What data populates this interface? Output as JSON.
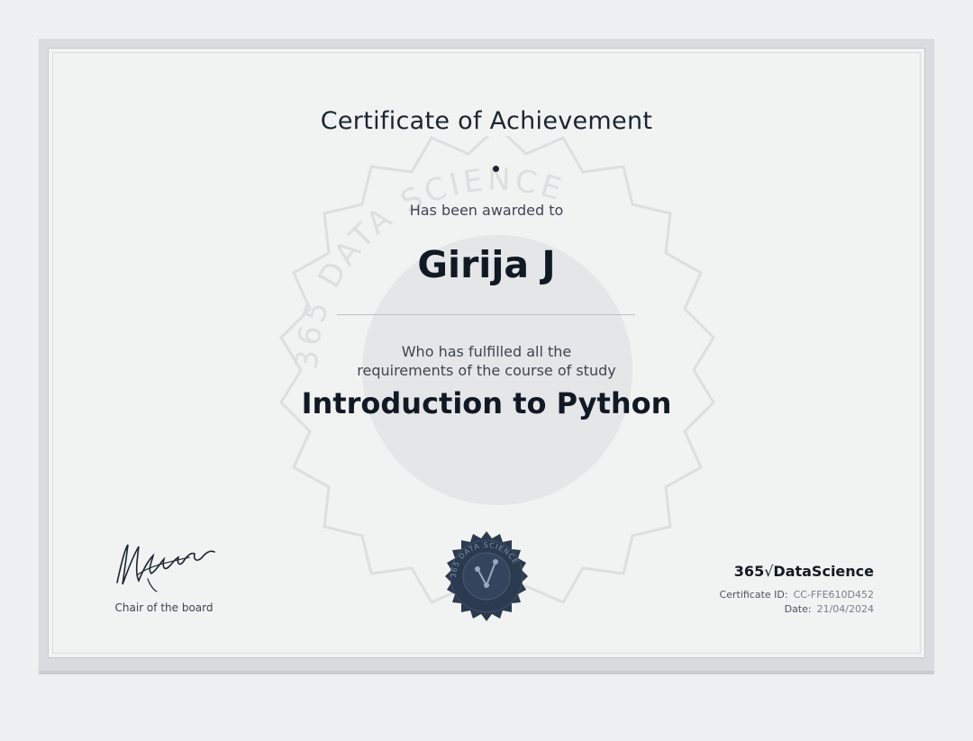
{
  "certificate": {
    "title": "Certificate of Achievement",
    "awarded_text": "Has been awarded to",
    "recipient": "Girija J",
    "fulfilled_line1": "Who has fulfilled all the",
    "fulfilled_line2": "requirements of the course of study",
    "course": "Introduction to Python"
  },
  "watermark": {
    "text": "365 DATA SCIENCE"
  },
  "signature": {
    "role": "Chair of the board"
  },
  "seal": {
    "text": "365 DATA SCIENCE"
  },
  "brand": {
    "prefix": "365",
    "mark": "√",
    "name": "DataScience"
  },
  "meta": {
    "id_label": "Certificate ID:",
    "id_value": "CC-FFE610D452",
    "date_label": "Date:",
    "date_value": "21/04/2024"
  },
  "colors": {
    "paper": "#f1f2f2",
    "frame": "#d9dcde",
    "seal": "#2b3a4e",
    "text": "#15202b"
  }
}
